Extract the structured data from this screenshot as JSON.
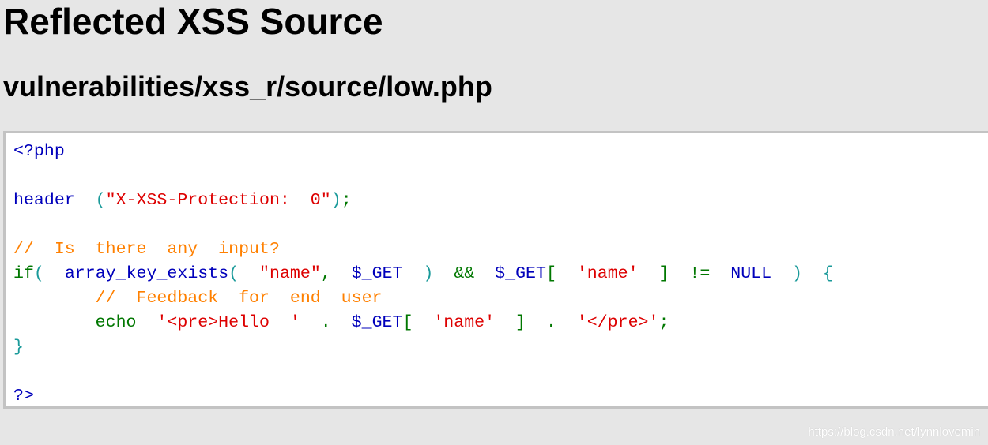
{
  "page": {
    "title": "Reflected XSS Source",
    "subtitle": "vulnerabilities/xss_r/source/low.php",
    "watermark": "https://blog.csdn.net/lynnlovemin"
  },
  "colors": {
    "keyword": "#007700",
    "default": "#0000bb",
    "string": "#dd0000",
    "comment": "#ff8000"
  },
  "code_lines": [
    [
      [
        "blue",
        "<?php"
      ]
    ],
    [],
    [
      [
        "blue",
        "header  "
      ],
      [
        "teal",
        "("
      ],
      [
        "red",
        "\"X-XSS-Protection:  0\""
      ],
      [
        "teal",
        ")"
      ],
      [
        "green",
        ";"
      ]
    ],
    [],
    [
      [
        "orange",
        "//  Is  there  any  input?"
      ]
    ],
    [
      [
        "green",
        "if"
      ],
      [
        "teal",
        "(  "
      ],
      [
        "blue",
        "array_key_exists"
      ],
      [
        "teal",
        "(  "
      ],
      [
        "red",
        "\"name\""
      ],
      [
        "green",
        ",  "
      ],
      [
        "blue",
        "$_GET  "
      ],
      [
        "teal",
        ")  "
      ],
      [
        "green",
        "&&  "
      ],
      [
        "blue",
        "$_GET"
      ],
      [
        "green",
        "[  "
      ],
      [
        "red",
        "'name'  "
      ],
      [
        "green",
        "]  !=  "
      ],
      [
        "blue",
        "NULL  "
      ],
      [
        "teal",
        ")  {"
      ]
    ],
    [
      [
        "orange",
        "        //  Feedback  for  end  user"
      ]
    ],
    [
      [
        "green",
        "        echo  "
      ],
      [
        "red",
        "'<pre>Hello  '  "
      ],
      [
        "green",
        ".  "
      ],
      [
        "blue",
        "$_GET"
      ],
      [
        "green",
        "[  "
      ],
      [
        "red",
        "'name'  "
      ],
      [
        "green",
        "]  .  "
      ],
      [
        "red",
        "'</pre>'"
      ],
      [
        "green",
        ";"
      ]
    ],
    [
      [
        "teal",
        "}"
      ]
    ],
    [],
    [
      [
        "blue",
        "?>"
      ]
    ]
  ]
}
